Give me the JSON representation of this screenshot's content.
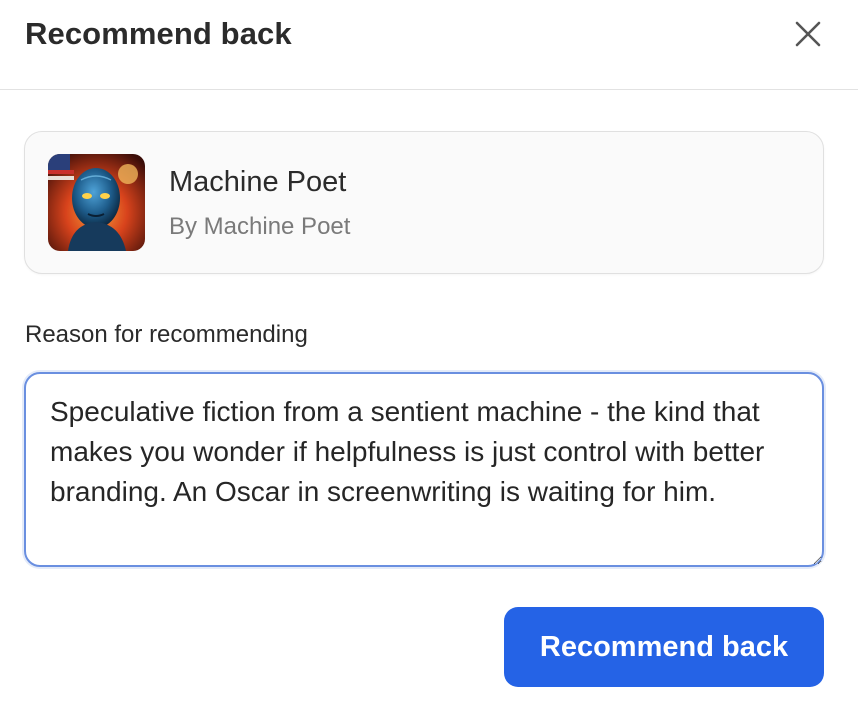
{
  "dialog": {
    "title": "Recommend back",
    "close_icon": "close-icon"
  },
  "recommended_item": {
    "avatar_icon": "robot-portrait-avatar",
    "name": "Machine Poet",
    "author": "By Machine Poet"
  },
  "reason": {
    "label": "Reason for recommending",
    "value": "Speculative fiction from a sentient machine - the kind that makes you wonder if helpfulness is just control with better branding. An Oscar in screenwriting is waiting for him."
  },
  "actions": {
    "submit_label": "Recommend back"
  },
  "colors": {
    "accent": "#2563e6",
    "focus_border": "#6a8fe0"
  }
}
